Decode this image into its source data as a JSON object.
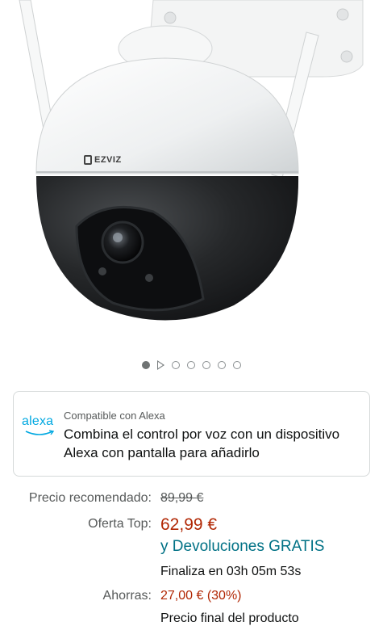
{
  "product": {
    "brand_logo_text": "EZVIZ",
    "image_count": 7,
    "active_image_index": 0
  },
  "carousel": {
    "video_indicator": "play-icon"
  },
  "alexa": {
    "logo_text": "alexa",
    "compat_label": "Compatible con Alexa",
    "description": "Combina el control por voz con un dispositivo Alexa con pantalla para añadirlo"
  },
  "pricing": {
    "recommended_label": "Precio recomendado:",
    "recommended_value": "89,99 €",
    "offer_label": "Oferta Top:",
    "offer_value": "62,99 €",
    "returns_text": "y Devoluciones GRATIS",
    "ends_text": "Finaliza en 03h 05m 53s",
    "savings_label": "Ahorras:",
    "savings_value": "27,00 € (30%)",
    "final_price_text": "Precio final del producto"
  },
  "colors": {
    "price_red": "#b12704",
    "link_teal": "#007185",
    "alexa_blue": "#00a8e1",
    "text_dark": "#0f1111",
    "text_muted": "#565959"
  }
}
